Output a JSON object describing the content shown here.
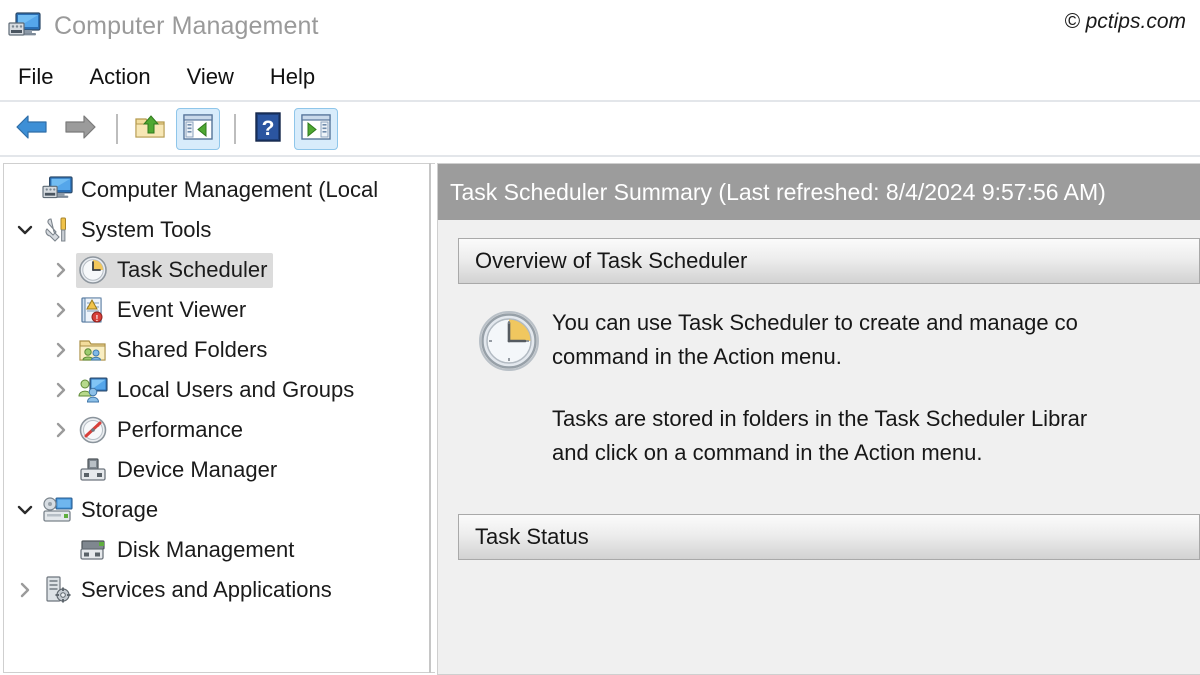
{
  "window": {
    "title": "Computer Management",
    "title_icon": "computer-management-icon",
    "watermark": "© pctips.com"
  },
  "menubar": {
    "items": [
      {
        "label": "File",
        "name": "menu-file"
      },
      {
        "label": "Action",
        "name": "menu-action"
      },
      {
        "label": "View",
        "name": "menu-view"
      },
      {
        "label": "Help",
        "name": "menu-help"
      }
    ]
  },
  "toolbar": {
    "buttons": [
      {
        "name": "back-button",
        "icon": "back-arrow-icon",
        "active": false
      },
      {
        "name": "forward-button",
        "icon": "forward-arrow-icon",
        "active": false
      },
      {
        "name": "up-one-level-button",
        "icon": "folder-up-icon",
        "active": false
      },
      {
        "name": "show-hide-console-tree-button",
        "icon": "console-tree-icon",
        "active": true
      },
      {
        "name": "help-button",
        "icon": "question-mark-icon",
        "active": false
      },
      {
        "name": "show-hide-action-pane-button",
        "icon": "action-pane-icon",
        "active": true
      }
    ]
  },
  "tree": {
    "items": [
      {
        "label": "Computer Management (Local",
        "icon": "computer-management-icon",
        "level": 0,
        "chevron": "none",
        "selected": false
      },
      {
        "label": "System Tools",
        "icon": "system-tools-icon",
        "level": 1,
        "chevron": "expanded",
        "selected": false
      },
      {
        "label": "Task Scheduler",
        "icon": "clock-icon",
        "level": 2,
        "chevron": "collapsed",
        "selected": true
      },
      {
        "label": "Event Viewer",
        "icon": "event-viewer-icon",
        "level": 2,
        "chevron": "collapsed",
        "selected": false
      },
      {
        "label": "Shared Folders",
        "icon": "shared-folders-icon",
        "level": 2,
        "chevron": "collapsed",
        "selected": false
      },
      {
        "label": "Local Users and Groups",
        "icon": "local-users-icon",
        "level": 2,
        "chevron": "collapsed",
        "selected": false
      },
      {
        "label": "Performance",
        "icon": "performance-icon",
        "level": 2,
        "chevron": "collapsed",
        "selected": false
      },
      {
        "label": "Device Manager",
        "icon": "device-manager-icon",
        "level": 2,
        "chevron": "none",
        "selected": false
      },
      {
        "label": "Storage",
        "icon": "storage-icon",
        "level": 1,
        "chevron": "expanded",
        "selected": false
      },
      {
        "label": "Disk Management",
        "icon": "disk-management-icon",
        "level": 2,
        "chevron": "none",
        "selected": false
      },
      {
        "label": "Services and Applications",
        "icon": "services-applications-icon",
        "level": 1,
        "chevron": "collapsed",
        "selected": false
      }
    ]
  },
  "right_pane": {
    "header": "Task Scheduler Summary (Last refreshed: 8/4/2024 9:57:56 AM)",
    "sections": [
      {
        "name": "overview-of-task-scheduler",
        "title": "Overview of Task Scheduler",
        "icon": "clock-icon",
        "paragraph1_line1": "You can use Task Scheduler to create and manage co",
        "paragraph1_line2": "command in the Action menu.",
        "paragraph2_line1": "Tasks are stored in folders in the Task Scheduler Librar",
        "paragraph2_line2": "and click on a command in the Action menu."
      },
      {
        "name": "task-status",
        "title": "Task Status"
      }
    ]
  },
  "colors": {
    "header_gray": "#9c9c9c",
    "pane_background": "#f0f0f0",
    "selection_gray": "#dcdcdc",
    "toolbar_active": "#d8ecfb",
    "title_text": "#9a9a9a"
  }
}
